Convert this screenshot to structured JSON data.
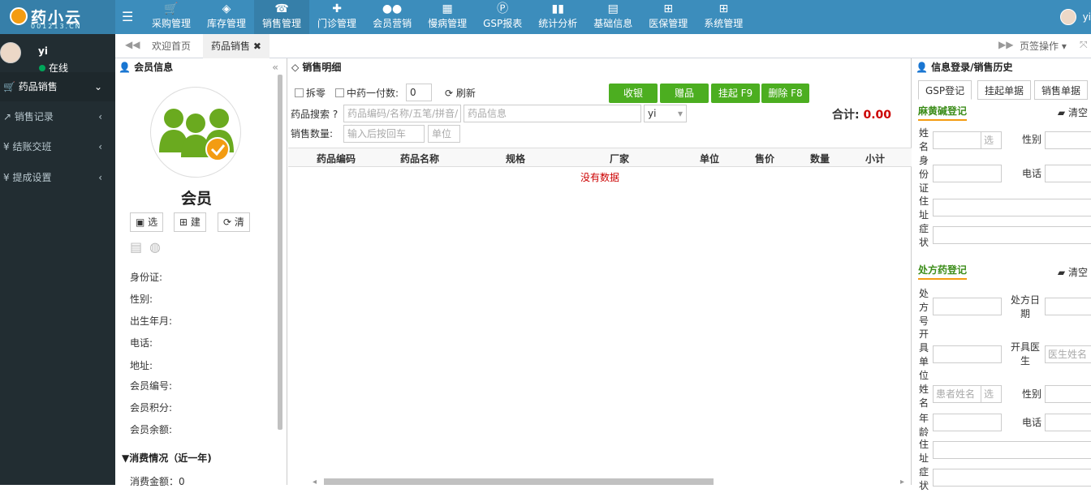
{
  "app": {
    "title": "药小云",
    "subtitle": "001213.CN",
    "user": "yi",
    "status": "在线"
  },
  "nav": [
    {
      "label": "采购管理",
      "icon": "cart-icon"
    },
    {
      "label": "库存管理",
      "icon": "box-icon"
    },
    {
      "label": "销售管理",
      "icon": "phone-icon"
    },
    {
      "label": "门诊管理",
      "icon": "medkit-icon"
    },
    {
      "label": "会员营销",
      "icon": "users-icon"
    },
    {
      "label": "慢病管理",
      "icon": "building-icon"
    },
    {
      "label": "GSP报表",
      "icon": "doc-icon"
    },
    {
      "label": "统计分析",
      "icon": "chart-icon"
    },
    {
      "label": "基础信息",
      "icon": "book-icon"
    },
    {
      "label": "医保管理",
      "icon": "windows-icon"
    },
    {
      "label": "系统管理",
      "icon": "windows-icon"
    }
  ],
  "sidebar": {
    "items": [
      {
        "label": "药品销售"
      },
      {
        "label": "销售记录"
      },
      {
        "label": "结账交班"
      },
      {
        "label": "提成设置"
      }
    ]
  },
  "tabs": {
    "home": "欢迎首页",
    "active": "药品销售",
    "ops": "页签操作"
  },
  "member": {
    "header": "会员信息",
    "title": "会员",
    "btn_select": "选",
    "btn_create": "建",
    "btn_clear": "清",
    "fields": [
      "身份证:",
      "性别:",
      "出生年月:",
      "电话:",
      "地址:",
      "会员编号:",
      "会员积分:",
      "会员余额:"
    ],
    "consume_title": "▼消费情况（近一年)",
    "consume_amount": "消费金额：0"
  },
  "sale": {
    "header": "销售明细",
    "split": "拆零",
    "tcm_label": "中药一付数:",
    "tcm_value": "0",
    "refresh": "刷新",
    "btn_checkout": "收银",
    "btn_gift": "赠品",
    "btn_hold": "挂起 F9",
    "btn_delete": "删除 F8",
    "search_label": "药品搜索",
    "search_placeholder": "药品编码/名称/五笔/拼音/条",
    "info_placeholder": "药品信息",
    "seller": "yi",
    "total_label": "合计:",
    "total_value": "0.00",
    "qty_label": "销售数量:",
    "qty_placeholder": "输入后按回车",
    "unit_placeholder": "单位",
    "columns": [
      "药品编码",
      "药品名称",
      "规格",
      "厂家",
      "单位",
      "售价",
      "数量",
      "小计"
    ],
    "nodata": "没有数据"
  },
  "right": {
    "header": "信息登录/销售历史",
    "tabs": [
      "GSP登记",
      "挂起单据",
      "销售单据"
    ],
    "section1": "麻黄碱登记",
    "section2": "处方药登记",
    "clear": "清空",
    "name": "姓名",
    "sex": "性别",
    "idcard": "身份证",
    "phone": "电话",
    "address": "住址",
    "symptom": "症状",
    "select": "选",
    "rx_no": "处方号",
    "rx_date": "处方日期",
    "issuer": "开具单位",
    "doctor": "开具医生",
    "doctor_placeholder": "医生姓名",
    "patient_placeholder": "患者姓名",
    "age": "年龄"
  }
}
